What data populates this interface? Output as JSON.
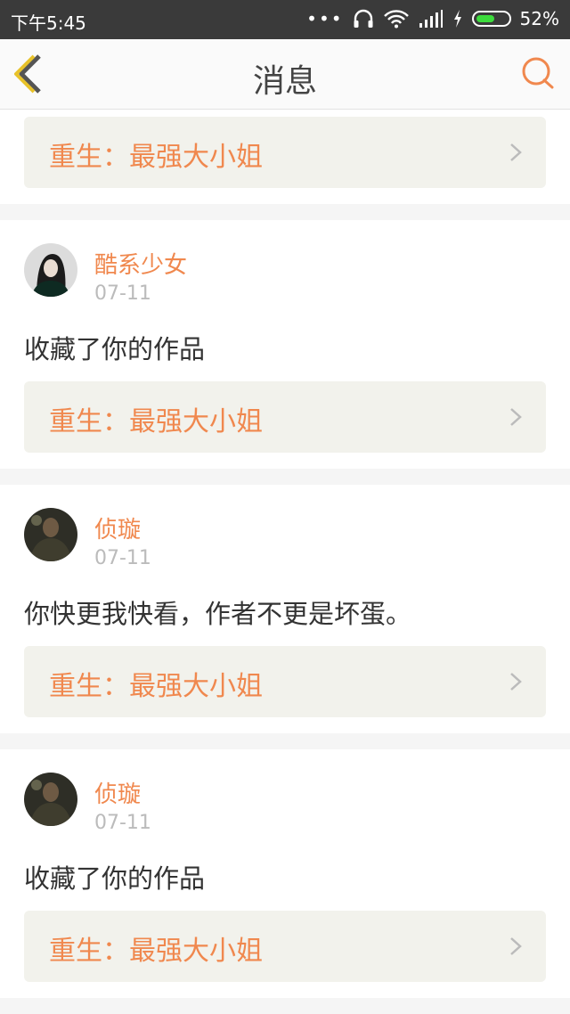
{
  "status": {
    "time": "下午5:45",
    "battery": "52%"
  },
  "nav": {
    "title": "消息"
  },
  "top_work": {
    "title": "重生：最强大小姐"
  },
  "messages": [
    {
      "user": "酷系少女",
      "date": "07-11",
      "text": "收藏了你的作品",
      "work": "重生：最强大小姐"
    },
    {
      "user": "侦璇",
      "date": "07-11",
      "text": "你快更我快看，作者不更是坏蛋。",
      "work": "重生：最强大小姐"
    },
    {
      "user": "侦璇",
      "date": "07-11",
      "text": "收藏了你的作品",
      "work": "重生：最强大小姐"
    }
  ],
  "colors": {
    "accent": "#f0884e",
    "back_arrow": "#e8c22a",
    "link_bg": "#f2f2ec"
  }
}
